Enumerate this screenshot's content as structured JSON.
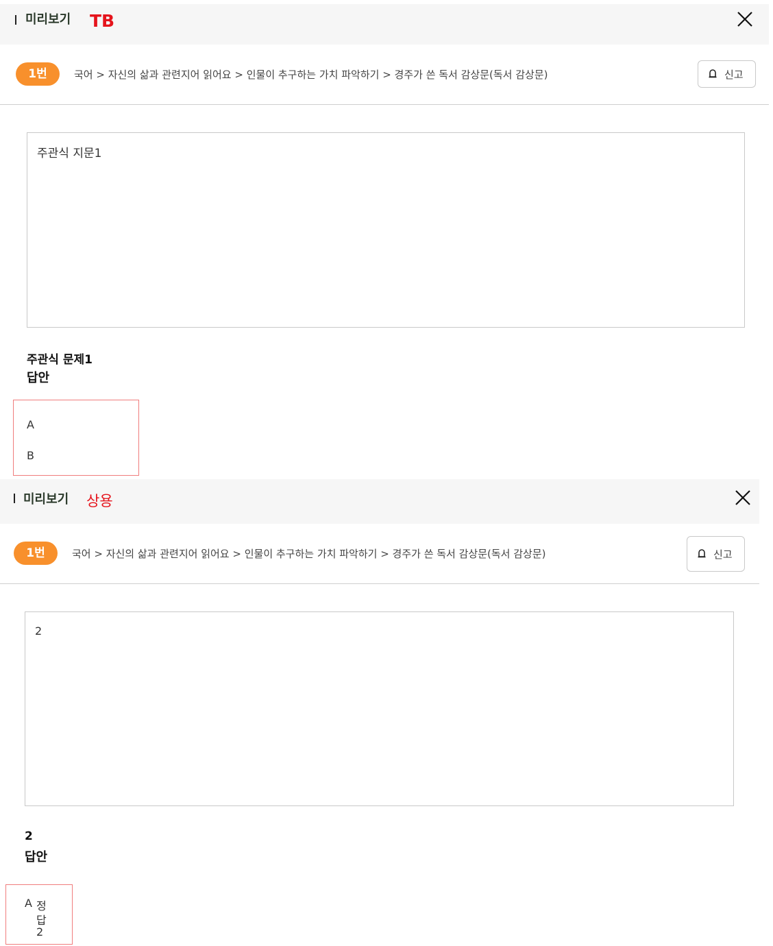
{
  "top": {
    "title": "미리보기",
    "tag": "TB",
    "badge": "1번",
    "breadcrumb": "국어 > 자신의 삶과 관련지어 읽어요 > 인물이 추구하는 가치 파악하기 > 경주가 쓴 독서 감상문(독서 감상문)",
    "report_label": "신고",
    "passage": "주관식 지문1",
    "question": "주관식 문제1",
    "answer_title": "답안",
    "options": [
      "A",
      "B"
    ]
  },
  "bottom": {
    "title": "미리보기",
    "tag": "상용",
    "badge": "1번",
    "breadcrumb": "국어 > 자신의 삶과 관련지어 읽어요 > 인물이 추구하는 가치 파악하기 > 경주가 쓴 독서 감상문(독서 감상문)",
    "report_label": "신고",
    "passage": "2",
    "question": "2",
    "answer_title": "답안",
    "answer_option_letter": "A",
    "answer_option_text_lines": [
      "정",
      "답",
      "2"
    ]
  },
  "colors": {
    "badge": "#f8902c",
    "tag": "#e5141c",
    "answer_border": "#f07c7c",
    "header_bg": "#f6f6f6"
  },
  "icons": {
    "close": "close-icon",
    "report": "bell-icon"
  }
}
